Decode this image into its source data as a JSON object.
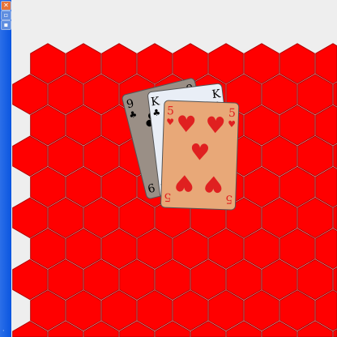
{
  "sidebar": {
    "buttons": [
      {
        "icon": "close-icon",
        "glyph": "✕",
        "color": "#e8743a"
      },
      {
        "icon": "window-icon",
        "glyph": "▫"
      },
      {
        "icon": "menu-icon",
        "glyph": "▪"
      }
    ],
    "bottom_icon": {
      "icon": "resize-icon",
      "glyph": "·"
    }
  },
  "board": {
    "tile_color": "#ff0000",
    "tile_border": "#b00000",
    "gap_color": "#f4e4dc",
    "background": "#eeeeee"
  },
  "cards": [
    {
      "rank": "9",
      "suit": "clubs",
      "suit_glyph": "♣",
      "color": "#000000",
      "face": "#9a8f86"
    },
    {
      "rank": "K",
      "suit": "clubs",
      "suit_glyph": "♣",
      "color": "#000000",
      "face": "#e9eef6"
    },
    {
      "rank": "5",
      "suit": "hearts",
      "suit_glyph": "♥",
      "color": "#e02020",
      "face": "#e8a878"
    }
  ]
}
